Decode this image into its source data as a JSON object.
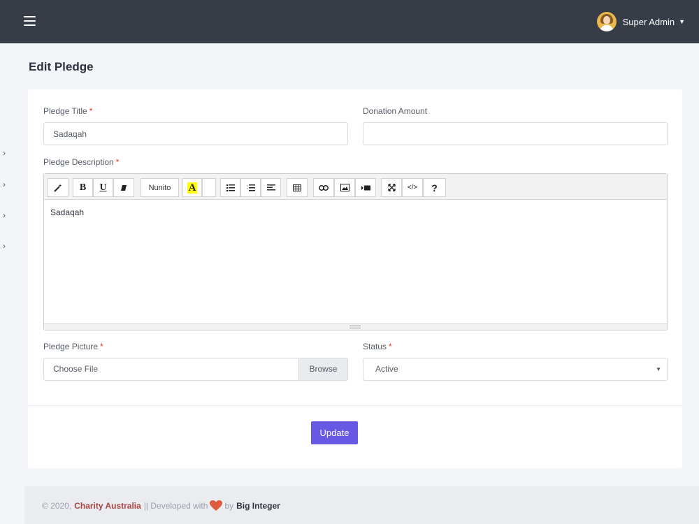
{
  "header": {
    "menu_icon": "hamburger-icon",
    "user_name": "Super Admin",
    "chevron": "˅"
  },
  "page": {
    "title": "Edit Pledge"
  },
  "form": {
    "pledge_title_label": "Pledge Title",
    "pledge_title_value": "Sadaqah",
    "donation_amount_label": "Donation Amount",
    "donation_amount_value": "",
    "description_label": "Pledge Description",
    "description_value": "Sadaqah",
    "toolbar": {
      "font_name": "Nunito",
      "color_letter": "A",
      "bold": "B",
      "underline": "U",
      "code": "</>",
      "help": "?"
    },
    "picture_label": "Pledge Picture",
    "file_placeholder": "Choose File",
    "browse_label": "Browse",
    "status_label": "Status",
    "status_value": "Active",
    "required_mark": "*",
    "update_label": "Update"
  },
  "footer": {
    "prefix": "© 2020,",
    "brand": "Charity Australia",
    "middle": "|| Developed with",
    "by": "by",
    "developer": "Big Integer"
  },
  "colors": {
    "topbar": "#373d46",
    "accent": "#6859e4",
    "required": "#e3342f",
    "brand": "#a94442"
  }
}
